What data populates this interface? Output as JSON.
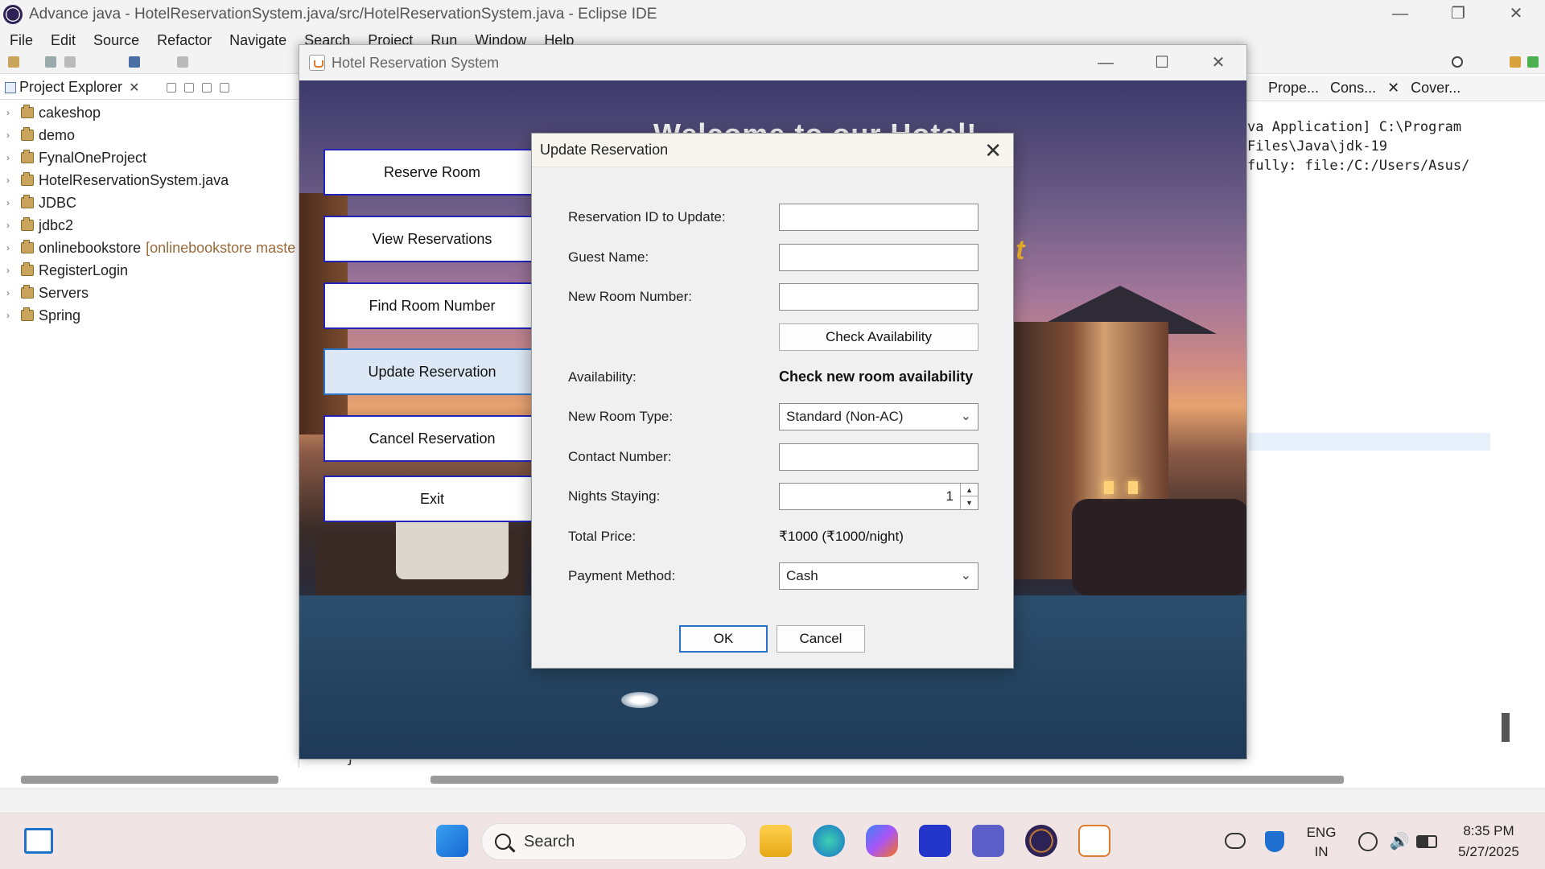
{
  "eclipse": {
    "title": "Advance java - HotelReservationSystem.java/src/HotelReservationSystem.java - Eclipse IDE",
    "menu": [
      "File",
      "Edit",
      "Source",
      "Refactor",
      "Navigate",
      "Search",
      "Project",
      "Run",
      "Window",
      "Help"
    ],
    "project_explorer": {
      "tab_label": "Project Explorer",
      "items": [
        {
          "label": "cakeshop",
          "suffix": ""
        },
        {
          "label": "demo",
          "suffix": ""
        },
        {
          "label": "FynalOneProject",
          "suffix": ""
        },
        {
          "label": "HotelReservationSystem.java",
          "suffix": ""
        },
        {
          "label": "JDBC",
          "suffix": ""
        },
        {
          "label": "jdbc2",
          "suffix": ""
        },
        {
          "label": "onlinebookstore",
          "suffix": "[onlinebookstore maste"
        },
        {
          "label": "RegisterLogin",
          "suffix": ""
        },
        {
          "label": "Servers",
          "suffix": ""
        },
        {
          "label": "Spring",
          "suffix": ""
        }
      ]
    },
    "right_tabs": [
      "Prope...",
      "Cons...",
      "Cover..."
    ],
    "console_lines": [
      "va Application] C:\\Program Files\\Java\\jdk-19",
      "fully: file:/C:/Users/Asus/"
    ],
    "code_tail": "}"
  },
  "hotel_window": {
    "title": "Hotel Reservation System",
    "welcome": "Welcome to our Hotel!",
    "accent_char": "t",
    "menu_buttons": [
      "Reserve Room",
      "View Reservations",
      "Find Room Number",
      "Update Reservation",
      "Cancel Reservation",
      "Exit"
    ],
    "active_button": "Update Reservation"
  },
  "dialog": {
    "title": "Update Reservation",
    "labels": {
      "reservation_id": "Reservation ID to Update:",
      "guest_name": "Guest Name:",
      "room_number": "New Room Number:",
      "availability": "Availability:",
      "room_type": "New Room Type:",
      "contact": "Contact Number:",
      "nights": "Nights Staying:",
      "total_price": "Total Price:",
      "payment": "Payment Method:"
    },
    "values": {
      "reservation_id": "",
      "guest_name": "",
      "room_number": "",
      "availability": "Check new room availability",
      "room_type": "Standard (Non-AC)",
      "contact": "",
      "nights": "1",
      "total_price": "₹1000 (₹1000/night)",
      "payment": "Cash"
    },
    "check_button": "Check Availability",
    "ok_button": "OK",
    "cancel_button": "Cancel"
  },
  "taskbar": {
    "search_label": "Search",
    "lang_top": "ENG",
    "lang_bottom": "IN",
    "time": "8:35 PM",
    "date": "5/27/2025"
  },
  "colors": {
    "button_border": "#2323b8",
    "active_button_bg": "#dce8f5",
    "accent_text": "#f0b429"
  }
}
